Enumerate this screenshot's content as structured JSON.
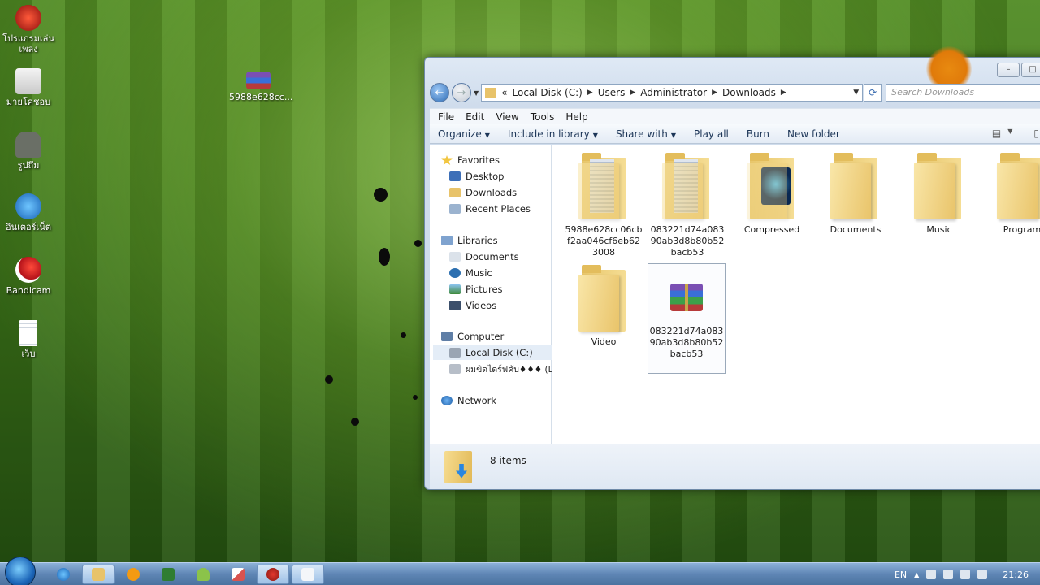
{
  "desktop": {
    "icons": [
      {
        "label": "โปรแกรมเล่นเพลง",
        "icon": "music-player-icon"
      },
      {
        "label": "มายโคชอบ",
        "icon": "computer-icon"
      },
      {
        "label": "รูปถึม",
        "icon": "android-icon"
      },
      {
        "label": "อินเตอร์เน็ต",
        "icon": "internet-explorer-icon"
      },
      {
        "label": "Bandicam",
        "icon": "bandicam-icon"
      },
      {
        "label": "เว็บ",
        "icon": "text-file-icon"
      },
      {
        "label": "5988e628cc...",
        "icon": "winrar-archive-icon"
      }
    ]
  },
  "window": {
    "caption_buttons": {
      "minimize": "–",
      "maximize": "□"
    },
    "address": {
      "prefix": "«",
      "crumbs": [
        "Local Disk (C:)",
        "Users",
        "Administrator",
        "Downloads"
      ]
    },
    "search_placeholder": "Search Downloads",
    "menu": [
      "File",
      "Edit",
      "View",
      "Tools",
      "Help"
    ],
    "commands": [
      "Organize",
      "Include in library",
      "Share with",
      "Play all",
      "Burn",
      "New folder"
    ],
    "nav": {
      "favorites": {
        "label": "Favorites",
        "items": [
          "Desktop",
          "Downloads",
          "Recent Places"
        ]
      },
      "libraries": {
        "label": "Libraries",
        "items": [
          "Documents",
          "Music",
          "Pictures",
          "Videos"
        ]
      },
      "computer": {
        "label": "Computer",
        "items": [
          "Local Disk (C:)",
          "ผมขิดไดร์ฟคับ♦♦♦ (D"
        ]
      },
      "network": {
        "label": "Network"
      }
    },
    "files": [
      {
        "name": "5988e628cc06cbf2aa046cf6eb623008",
        "type": "folder-docs"
      },
      {
        "name": "083221d74a08390ab3d8b80b52bacb53",
        "type": "folder-docs"
      },
      {
        "name": "Compressed",
        "type": "folder-media"
      },
      {
        "name": "Documents",
        "type": "folder"
      },
      {
        "name": "Music",
        "type": "folder"
      },
      {
        "name": "Program",
        "type": "folder"
      },
      {
        "name": "Video",
        "type": "folder"
      },
      {
        "name": "083221d74a08390ab3d8b80b52bacb53",
        "type": "winrar-archive",
        "selected": true
      }
    ],
    "status": {
      "count_text": "8 items"
    }
  },
  "taskbar": {
    "apps": [
      "windows-explorer-icon",
      "media-player-icon",
      "excel-icon",
      "android-icon",
      "paint-icon",
      "bandicam-icon",
      "notepad-icon"
    ],
    "tray": {
      "language": "EN",
      "time": "21:26"
    }
  },
  "colors": {
    "accent": "#3a6fd8",
    "desktop_green": "#3c7419",
    "selection": "#e4edf7"
  }
}
